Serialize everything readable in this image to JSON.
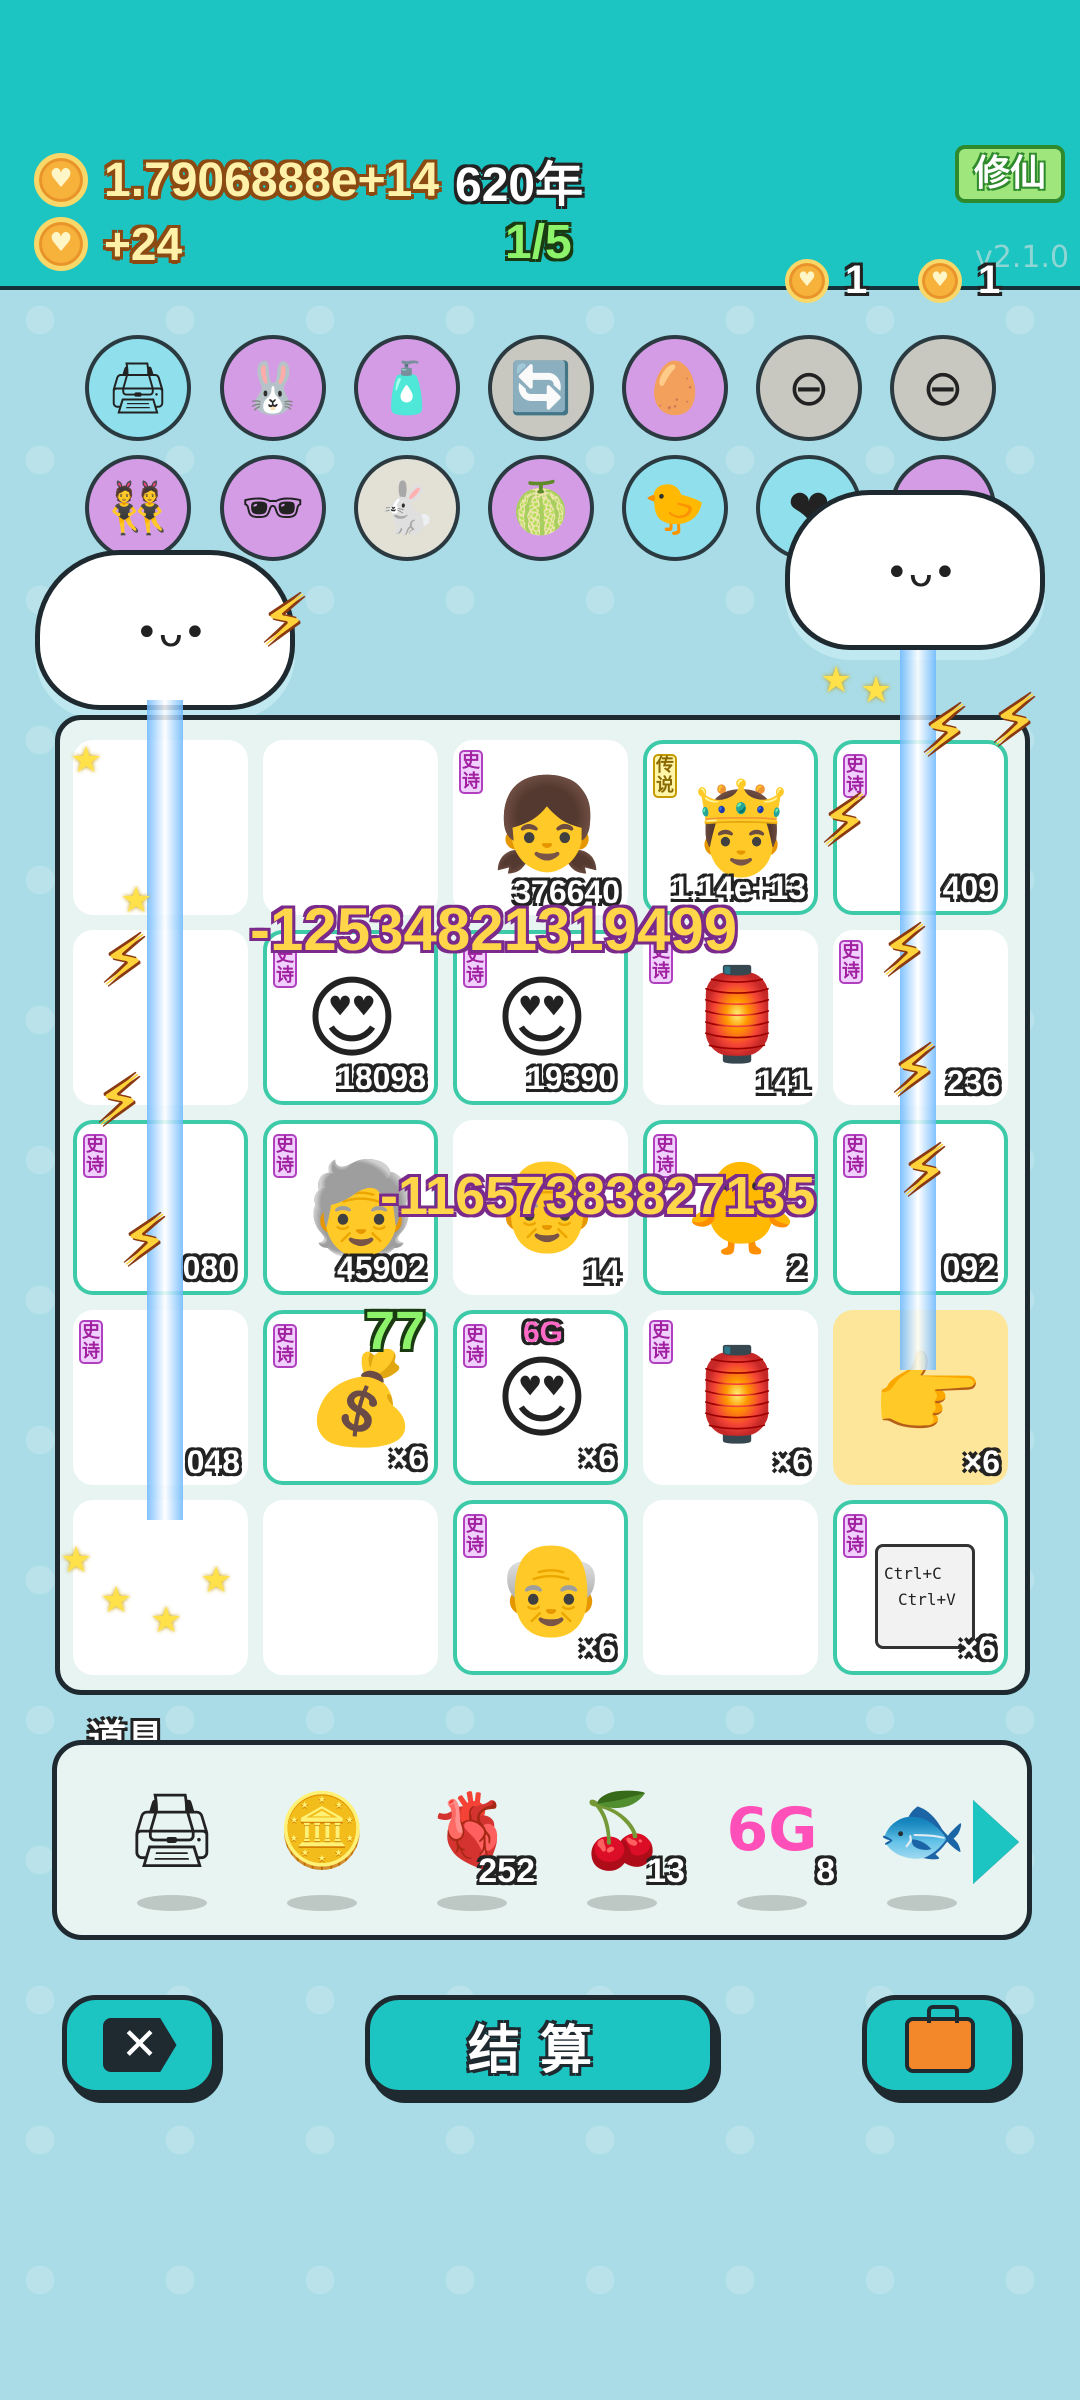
{
  "header": {
    "gold_total": "1.7906888e+14",
    "years": "620年",
    "gold_rate": "+24",
    "stage": "1/5",
    "xiuxian_label": "修仙",
    "version": "v2.1.0",
    "coin_badge_a": "1",
    "coin_badge_b": "1"
  },
  "skills": {
    "row1": [
      "printer-warning-icon",
      "rabbit-icon",
      "spray-bottle-icon",
      "refresh-icon",
      "egg-icon",
      "minus-icon",
      "minus-icon"
    ],
    "row2": [
      "twin-figures-icon",
      "sunglasses-icon",
      "rabbit-icon",
      "grapefruit-icon",
      "chick-icon",
      "heart-potion-icon",
      "partial-icon"
    ]
  },
  "board": {
    "cells": [
      {
        "tag": "",
        "num": ""
      },
      {
        "tag": "",
        "num": ""
      },
      {
        "tag": "史诗",
        "num": "376640"
      },
      {
        "tag": "传说",
        "num": "1.14e+13"
      },
      {
        "tag": "史诗",
        "num": "409"
      },
      {
        "tag": "",
        "num": ""
      },
      {
        "tag": "史诗",
        "num": "18098"
      },
      {
        "tag": "史诗",
        "num": "19390"
      },
      {
        "tag": "史诗",
        "num": "141"
      },
      {
        "tag": "史诗",
        "num": "236"
      },
      {
        "tag": "史诗",
        "num": "080"
      },
      {
        "tag": "史诗",
        "num": "45902"
      },
      {
        "tag": "",
        "num": "14"
      },
      {
        "tag": "史诗",
        "num": "2"
      },
      {
        "tag": "史诗",
        "num": "092"
      },
      {
        "tag": "史诗",
        "num": "048"
      },
      {
        "tag": "史诗",
        "num": "×6"
      },
      {
        "tag": "史诗",
        "num": "×6"
      },
      {
        "tag": "史诗",
        "num": "×6"
      },
      {
        "tag": "",
        "num": "×6"
      },
      {
        "tag": "",
        "num": ""
      },
      {
        "tag": "",
        "num": ""
      },
      {
        "tag": "史诗",
        "num": "×6"
      },
      {
        "tag": "",
        "num": ""
      },
      {
        "tag": "史诗",
        "num": "×6"
      }
    ],
    "float_a": "-12534821319499",
    "float_b": "-11657383827135",
    "float_c": "77",
    "label_6g": "6G",
    "ctrl_c": "Ctrl+C",
    "ctrl_v": "Ctrl+V"
  },
  "props": {
    "title": "道具",
    "items": [
      {
        "icon": "printer-icon",
        "count": ""
      },
      {
        "icon": "dollar-coin-icon",
        "count": ""
      },
      {
        "icon": "liver-icon",
        "count": "252"
      },
      {
        "icon": "bayberry-icon",
        "count": "13"
      },
      {
        "icon": "6g-icon",
        "count": "8"
      },
      {
        "icon": "koi-icon",
        "count": ""
      }
    ],
    "label_6g": "6G"
  },
  "buttons": {
    "settle_label": "结算"
  }
}
